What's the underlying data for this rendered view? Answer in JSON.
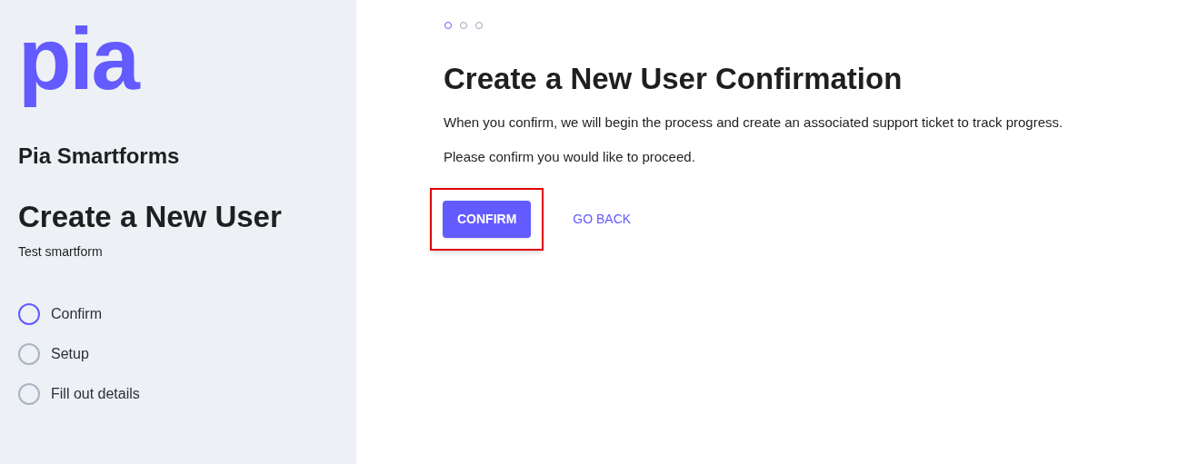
{
  "sidebar": {
    "logo": "pia",
    "app_name": "Pia Smartforms",
    "title": "Create a New User",
    "subtitle": "Test smartform",
    "steps": [
      {
        "label": "Confirm",
        "selected": true
      },
      {
        "label": "Setup",
        "selected": false
      },
      {
        "label": "Fill out details",
        "selected": false
      }
    ]
  },
  "main": {
    "progress_dots": [
      {
        "selected": true
      },
      {
        "selected": false
      },
      {
        "selected": false
      }
    ],
    "title": "Create a New User Confirmation",
    "paragraphs": [
      "When you confirm, we will begin the process and create an associated support ticket to track progress.",
      "Please confirm you would like to proceed."
    ],
    "buttons": [
      {
        "label": "CONFIRM",
        "kind": "primary",
        "highlighted": true
      },
      {
        "label": "GO BACK",
        "kind": "link",
        "highlighted": false
      }
    ]
  }
}
